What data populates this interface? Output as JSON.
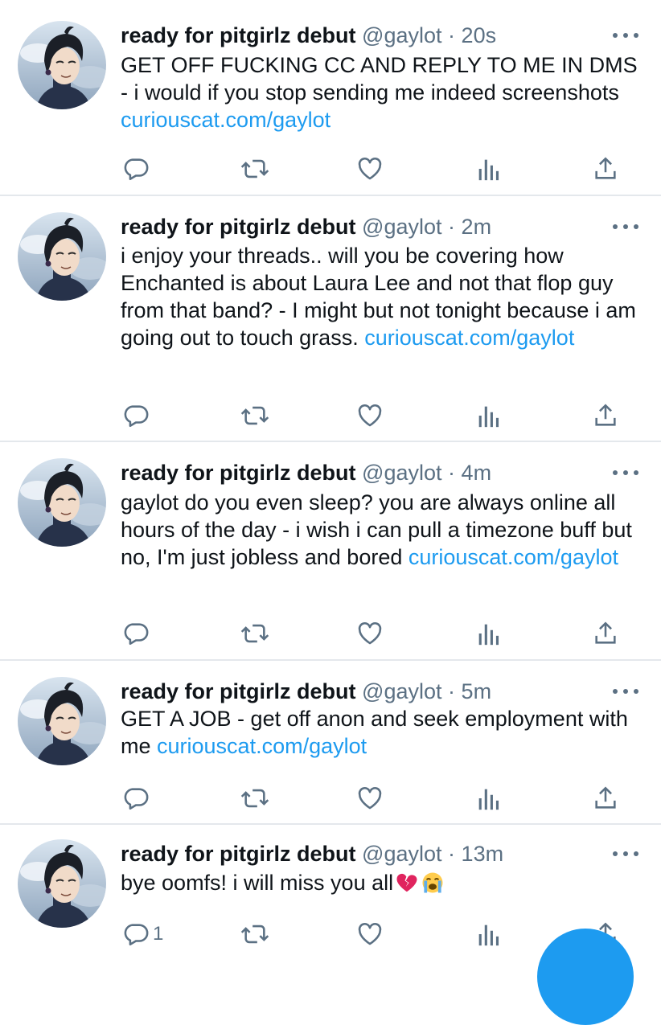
{
  "colors": {
    "link": "#1d9bf0",
    "secondary_text": "#5b7083",
    "divider": "#e4e8ec",
    "fab": "#1d9bf0"
  },
  "icons": {
    "reply": "reply-icon",
    "retweet": "retweet-icon",
    "like": "like-icon",
    "analytics": "analytics-icon",
    "share": "share-icon",
    "more": "more-icon"
  },
  "tweets": [
    {
      "name": "ready for pitgirlz debut",
      "handle": "@gaylot",
      "dot": "·",
      "time": "20s",
      "text": "GET OFF FUCKING CC AND REPLY TO ME IN DMS - i would if you stop sending me indeed screenshots ",
      "link": "curiouscat.com/gaylot",
      "reply_count": ""
    },
    {
      "name": "ready for pitgirlz debut",
      "handle": "@gaylot",
      "dot": "·",
      "time": "2m",
      "text": "i enjoy your threads.. will you be covering how Enchanted is about Laura Lee and not that flop guy from that band? - I might but not tonight because i am going out to touch grass. ",
      "link": "curiouscat.com/gaylot",
      "reply_count": ""
    },
    {
      "name": "ready for pitgirlz debut",
      "handle": "@gaylot",
      "dot": "·",
      "time": "4m",
      "text": "gaylot do you even sleep? you are always online all hours of the day - i wish i can pull a timezone buff but no, I'm just jobless and bored ",
      "link": "curiouscat.com/gaylot",
      "reply_count": ""
    },
    {
      "name": "ready for pitgirlz debut",
      "handle": "@gaylot",
      "dot": "·",
      "time": "5m",
      "text": "GET A JOB - get off anon and seek employment with me ",
      "link": "curiouscat.com/gaylot",
      "reply_count": ""
    },
    {
      "name": "ready for pitgirlz debut",
      "handle": "@gaylot",
      "dot": "·",
      "time": "13m",
      "text": "bye oomfs! i will miss you all",
      "link": "",
      "emoji": "broken-heart-emoji, loudly-crying-face-emoji",
      "reply_count": "1"
    }
  ]
}
